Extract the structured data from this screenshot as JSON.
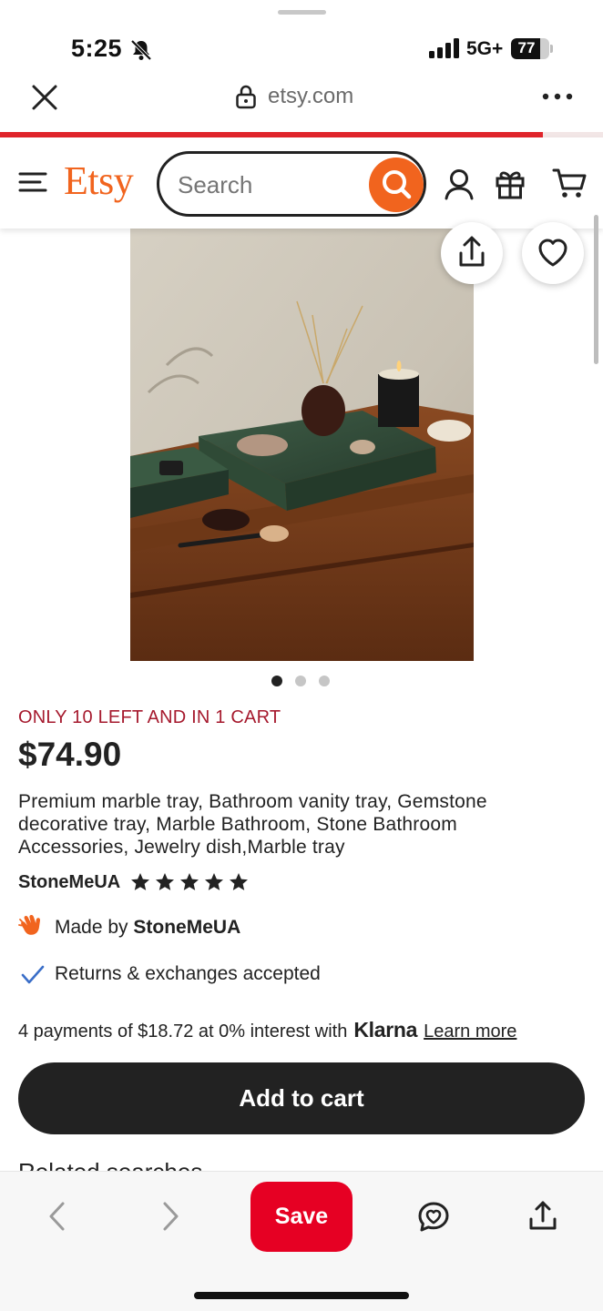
{
  "status_bar": {
    "time": "5:25",
    "network": "5G+",
    "battery": "77",
    "battery_level": 0.77
  },
  "browser": {
    "url": "etsy.com",
    "page_load_progress": 0.9
  },
  "header": {
    "logo": "Etsy",
    "search_placeholder": "Search"
  },
  "product": {
    "image_dots_count": 3,
    "image_dot_active": 1,
    "stock_notice": "ONLY 10 LEFT AND IN 1 CART",
    "price": "$74.90",
    "title": "Premium marble tray, Bathroom vanity tray, Gemstone decorative tray, Marble Bathroom, Stone Bathroom Accessories, Jewelry dish,Marble tray",
    "shop_name": "StoneMeUA",
    "rating_stars": 5,
    "made_by_prefix": "Made by",
    "made_by_shop": "StoneMeUA",
    "returns": "Returns & exchanges accepted",
    "klarna_text": "4 payments of $18.72 at 0% interest with",
    "klarna_brand": "Klarna",
    "learn_more": "Learn more",
    "add_to_cart": "Add to cart",
    "next_section_peek": "Related searches"
  },
  "toolbar": {
    "save_label": "Save"
  },
  "colors": {
    "etsy_orange": "#f1641e",
    "stock_red": "#a61a2e",
    "save_red": "#e60023",
    "button_dark": "#222222"
  },
  "icons": [
    "bell-off-icon",
    "signal-icon",
    "battery-icon",
    "close-icon",
    "lock-icon",
    "more-icon",
    "hamburger-icon",
    "search-icon",
    "user-icon",
    "gift-icon",
    "cart-icon",
    "share-icon",
    "heart-icon",
    "star-icon",
    "hand-wave-icon",
    "check-icon",
    "chevron-left-icon",
    "chevron-right-icon",
    "chat-icon"
  ]
}
